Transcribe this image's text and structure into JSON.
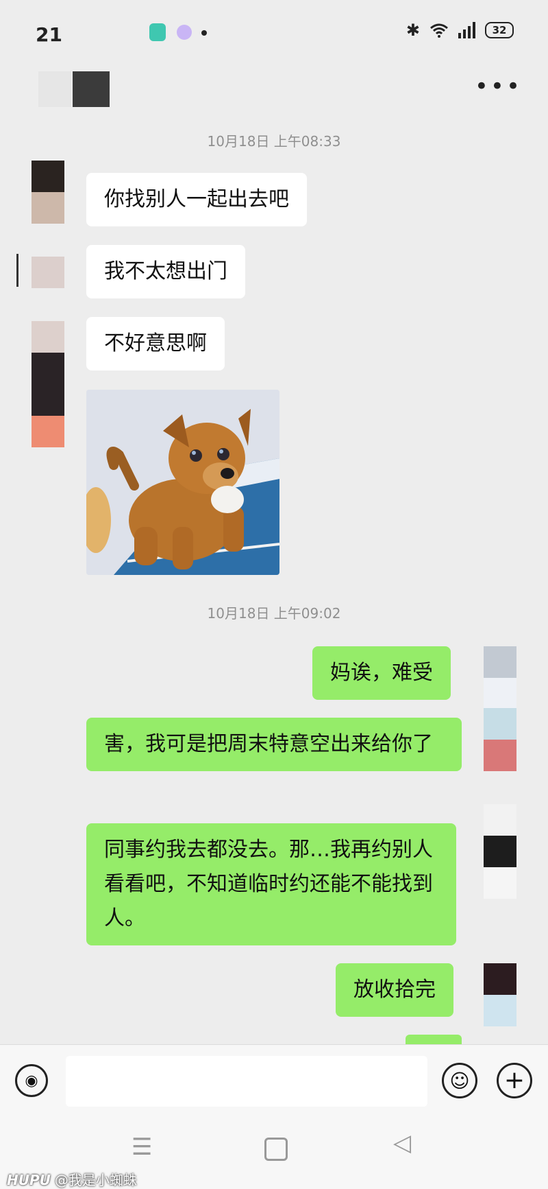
{
  "status_bar": {
    "time": "21",
    "battery": "32"
  },
  "header": {
    "more_icon": "more-dots-icon"
  },
  "timestamps": [
    "10月18日 上午08:33",
    "10月18日 上午09:02"
  ],
  "messages": [
    {
      "side": "left",
      "text": "你找别人一起出去吧"
    },
    {
      "side": "left",
      "text": "我不太想出门"
    },
    {
      "side": "left",
      "text": "不好意思啊"
    },
    {
      "side": "left",
      "type": "image",
      "image": "puppy-sticker"
    },
    {
      "side": "right",
      "text": "妈诶，难受"
    },
    {
      "side": "right",
      "text": "害，我可是把周末特意空出来给你了"
    },
    {
      "side": "right",
      "text": "同事约我去都没去。那…我再约别人看看吧，不知道临时约还能不能找到人。"
    },
    {
      "side": "right",
      "text": "放收拾完"
    }
  ],
  "input": {
    "value": "",
    "placeholder": ""
  },
  "watermark": {
    "brand": "HUPU",
    "user": "@我是小蜘蛛"
  },
  "colors": {
    "background": "#ededed",
    "my_bubble": "#95ec69",
    "their_bubble": "#ffffff"
  }
}
